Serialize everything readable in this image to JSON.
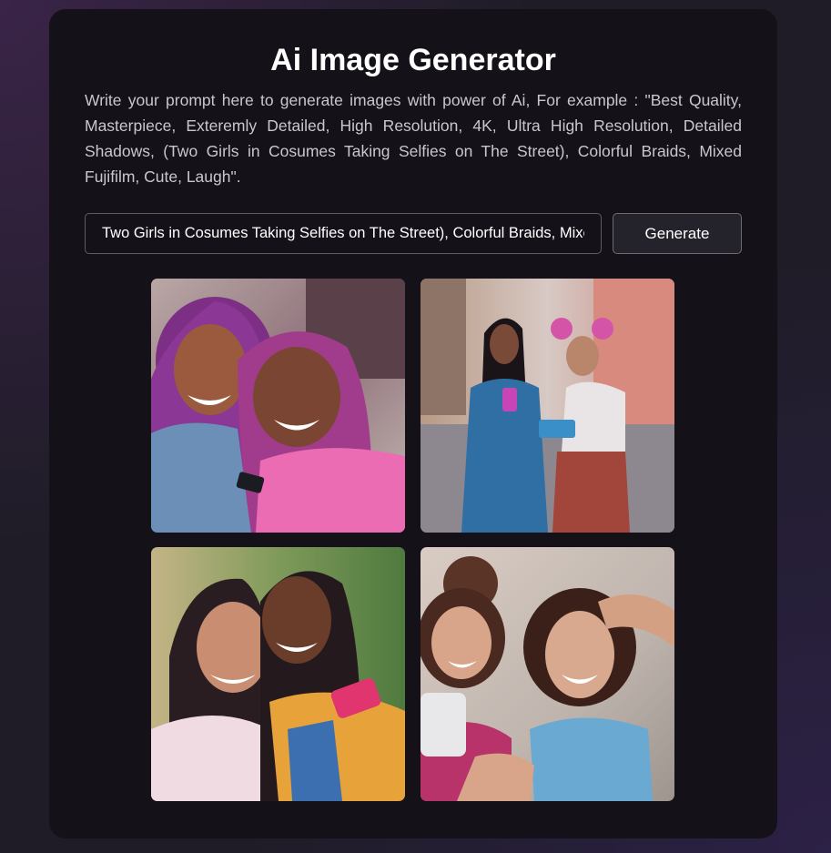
{
  "app": {
    "title": "Ai Image Generator",
    "description": "Write your prompt here to generate images with power of Ai, For example : \"Best Quality, Masterpiece, Exteremly Detailed, High Resolution, 4K, Ultra High Resolution, Detailed Shadows, (Two Girls in Cosumes Taking Selfies on The Street), Colorful Braids, Mixed Fujifilm, Cute, Laugh\"."
  },
  "prompt": {
    "value": "Two Girls in Cosumes Taking Selfies on The Street), Colorful Braids, Mixed Fujifilm, Cute, Laugh"
  },
  "generate_button": {
    "label": "Generate"
  },
  "gallery": {
    "images": [
      {
        "subject": "two girls with pink braids smiling at phone"
      },
      {
        "subject": "two girls taking selfies on a city street"
      },
      {
        "subject": "two girls with braids taking a selfie"
      },
      {
        "subject": "two girls with curly hair laughing and taking selfie"
      }
    ]
  },
  "colors": {
    "page_background": "#1f1c27",
    "card_background": "#141218",
    "text_primary": "#ffffff",
    "text_secondary": "#c9c6cf",
    "input_border": "#5e5b66",
    "button_background": "#24232b"
  }
}
